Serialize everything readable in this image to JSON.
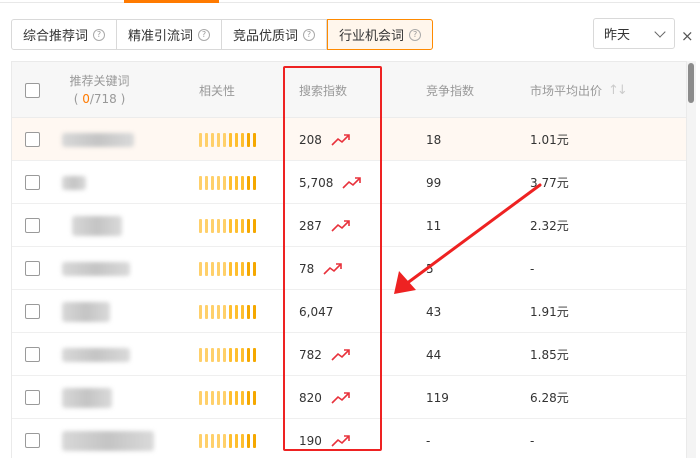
{
  "tabs": [
    {
      "label": "综合推荐词",
      "active": false
    },
    {
      "label": "精准引流词",
      "active": false
    },
    {
      "label": "竞品优质词",
      "active": false
    },
    {
      "label": "行业机会词",
      "active": true
    }
  ],
  "date_filter": {
    "selected": "昨天"
  },
  "table": {
    "headers": {
      "keyword": "推荐关键词",
      "selected_count": "0",
      "total_count": "/718",
      "relevance": "相关性",
      "search_index": "搜索指数",
      "competition_index": "竞争指数",
      "avg_bid": "市场平均出价"
    },
    "rows": [
      {
        "search_index": "208",
        "competition": "18",
        "avg_bid": "1.01元",
        "trend": "up",
        "highlighted": true
      },
      {
        "search_index": "5,708",
        "competition": "99",
        "avg_bid": "3.77元",
        "trend": "up",
        "highlighted": false
      },
      {
        "search_index": "287",
        "competition": "11",
        "avg_bid": "2.32元",
        "trend": "up",
        "highlighted": false
      },
      {
        "search_index": "78",
        "competition": "5",
        "avg_bid": "-",
        "trend": "up",
        "highlighted": false
      },
      {
        "search_index": "6,047",
        "competition": "43",
        "avg_bid": "1.91元",
        "trend": "none",
        "highlighted": false
      },
      {
        "search_index": "782",
        "competition": "44",
        "avg_bid": "1.85元",
        "trend": "up",
        "highlighted": false
      },
      {
        "search_index": "820",
        "competition": "119",
        "avg_bid": "6.28元",
        "trend": "up",
        "highlighted": false
      },
      {
        "search_index": "190",
        "competition": "-",
        "avg_bid": "-",
        "trend": "up",
        "highlighted": false
      }
    ]
  },
  "colors": {
    "accent": "#ff7a00",
    "annotation_red": "#ee2222",
    "trend_red": "#e8323c",
    "relevance_bar": "#f5a800"
  }
}
